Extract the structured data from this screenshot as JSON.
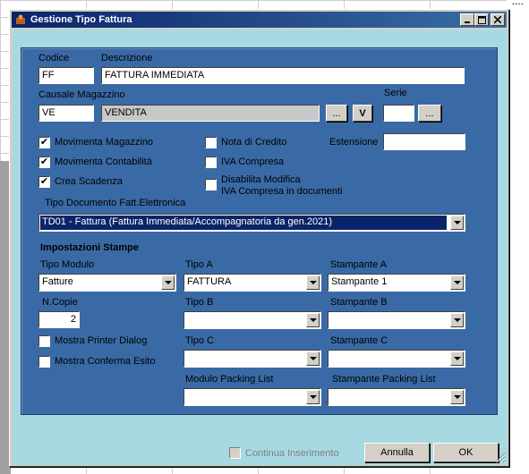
{
  "background": {
    "ellipsis": "...."
  },
  "window": {
    "title": "Gestione Tipo Fattura"
  },
  "fields": {
    "codice_label": "Codice",
    "codice_value": "FF",
    "descrizione_label": "Descrizione",
    "descrizione_value": "FATTURA IMMEDIATA",
    "causale_label": "Causale Magazzino",
    "causale_code": "VE",
    "causale_desc": "VENDITA",
    "causale_browse_label": "...",
    "causale_v_label": "V",
    "serie_label": "Serie",
    "serie_value": "",
    "serie_browse_label": "...",
    "estensione_label": "Estensione",
    "estensione_value": ""
  },
  "checkboxes": {
    "movimenta_magazzino": {
      "label": "Movimenta Magazzino",
      "checked": true
    },
    "movimenta_contabilita": {
      "label": "Movimenta Contabilità",
      "checked": true
    },
    "crea_scadenza": {
      "label": "Crea Scadenza",
      "checked": true
    },
    "nota_di_credito": {
      "label": "Nota di Credito",
      "checked": false
    },
    "iva_compresa": {
      "label": "IVA Compresa",
      "checked": false
    },
    "disabilita_modifica": {
      "label_line1": "Disabilita  Modifica",
      "label_line2": "IVA Compresa in documenti",
      "checked": false
    },
    "mostra_printer_dialog": {
      "label": "Mostra Printer Dialog",
      "checked": false
    },
    "mostra_conferma_esito": {
      "label": "Mostra Conferma Esito",
      "checked": false
    }
  },
  "tipo_documento": {
    "label": "Tipo Documento Fatt.Elettronica",
    "value": "TD01 - Fattura (Fattura Immediata/Accompagnatoria da gen.2021)"
  },
  "stampe": {
    "section_title": "Impostazioni Stampe",
    "tipo_modulo_label": "Tipo Modulo",
    "tipo_modulo_value": "Fatture",
    "n_copie_label": "N.Copie",
    "n_copie_value": "2",
    "tipo_a_label": "Tipo A",
    "tipo_a_value": "FATTURA",
    "tipo_b_label": "Tipo B",
    "tipo_b_value": "",
    "tipo_c_label": "Tipo C",
    "tipo_c_value": "",
    "modulo_packing_label": "Modulo Packing List",
    "modulo_packing_value": "",
    "stampante_a_label": "Stampante A",
    "stampante_a_value": "Stampante 1",
    "stampante_b_label": "Stampante B",
    "stampante_b_value": "",
    "stampante_c_label": "Stampante C",
    "stampante_c_value": "",
    "stampante_packing_label": "Stampante Packing List",
    "stampante_packing_value": ""
  },
  "footer": {
    "continua_inserimento_label": "Continua Inserimento",
    "annulla_label": "Annulla",
    "ok_label": "OK"
  },
  "colors": {
    "panel_blue": "#3a6aa6",
    "frame_cyan": "#a7d9e2",
    "title_blue": "#0a246a",
    "selection_blue": "#0a246a"
  }
}
